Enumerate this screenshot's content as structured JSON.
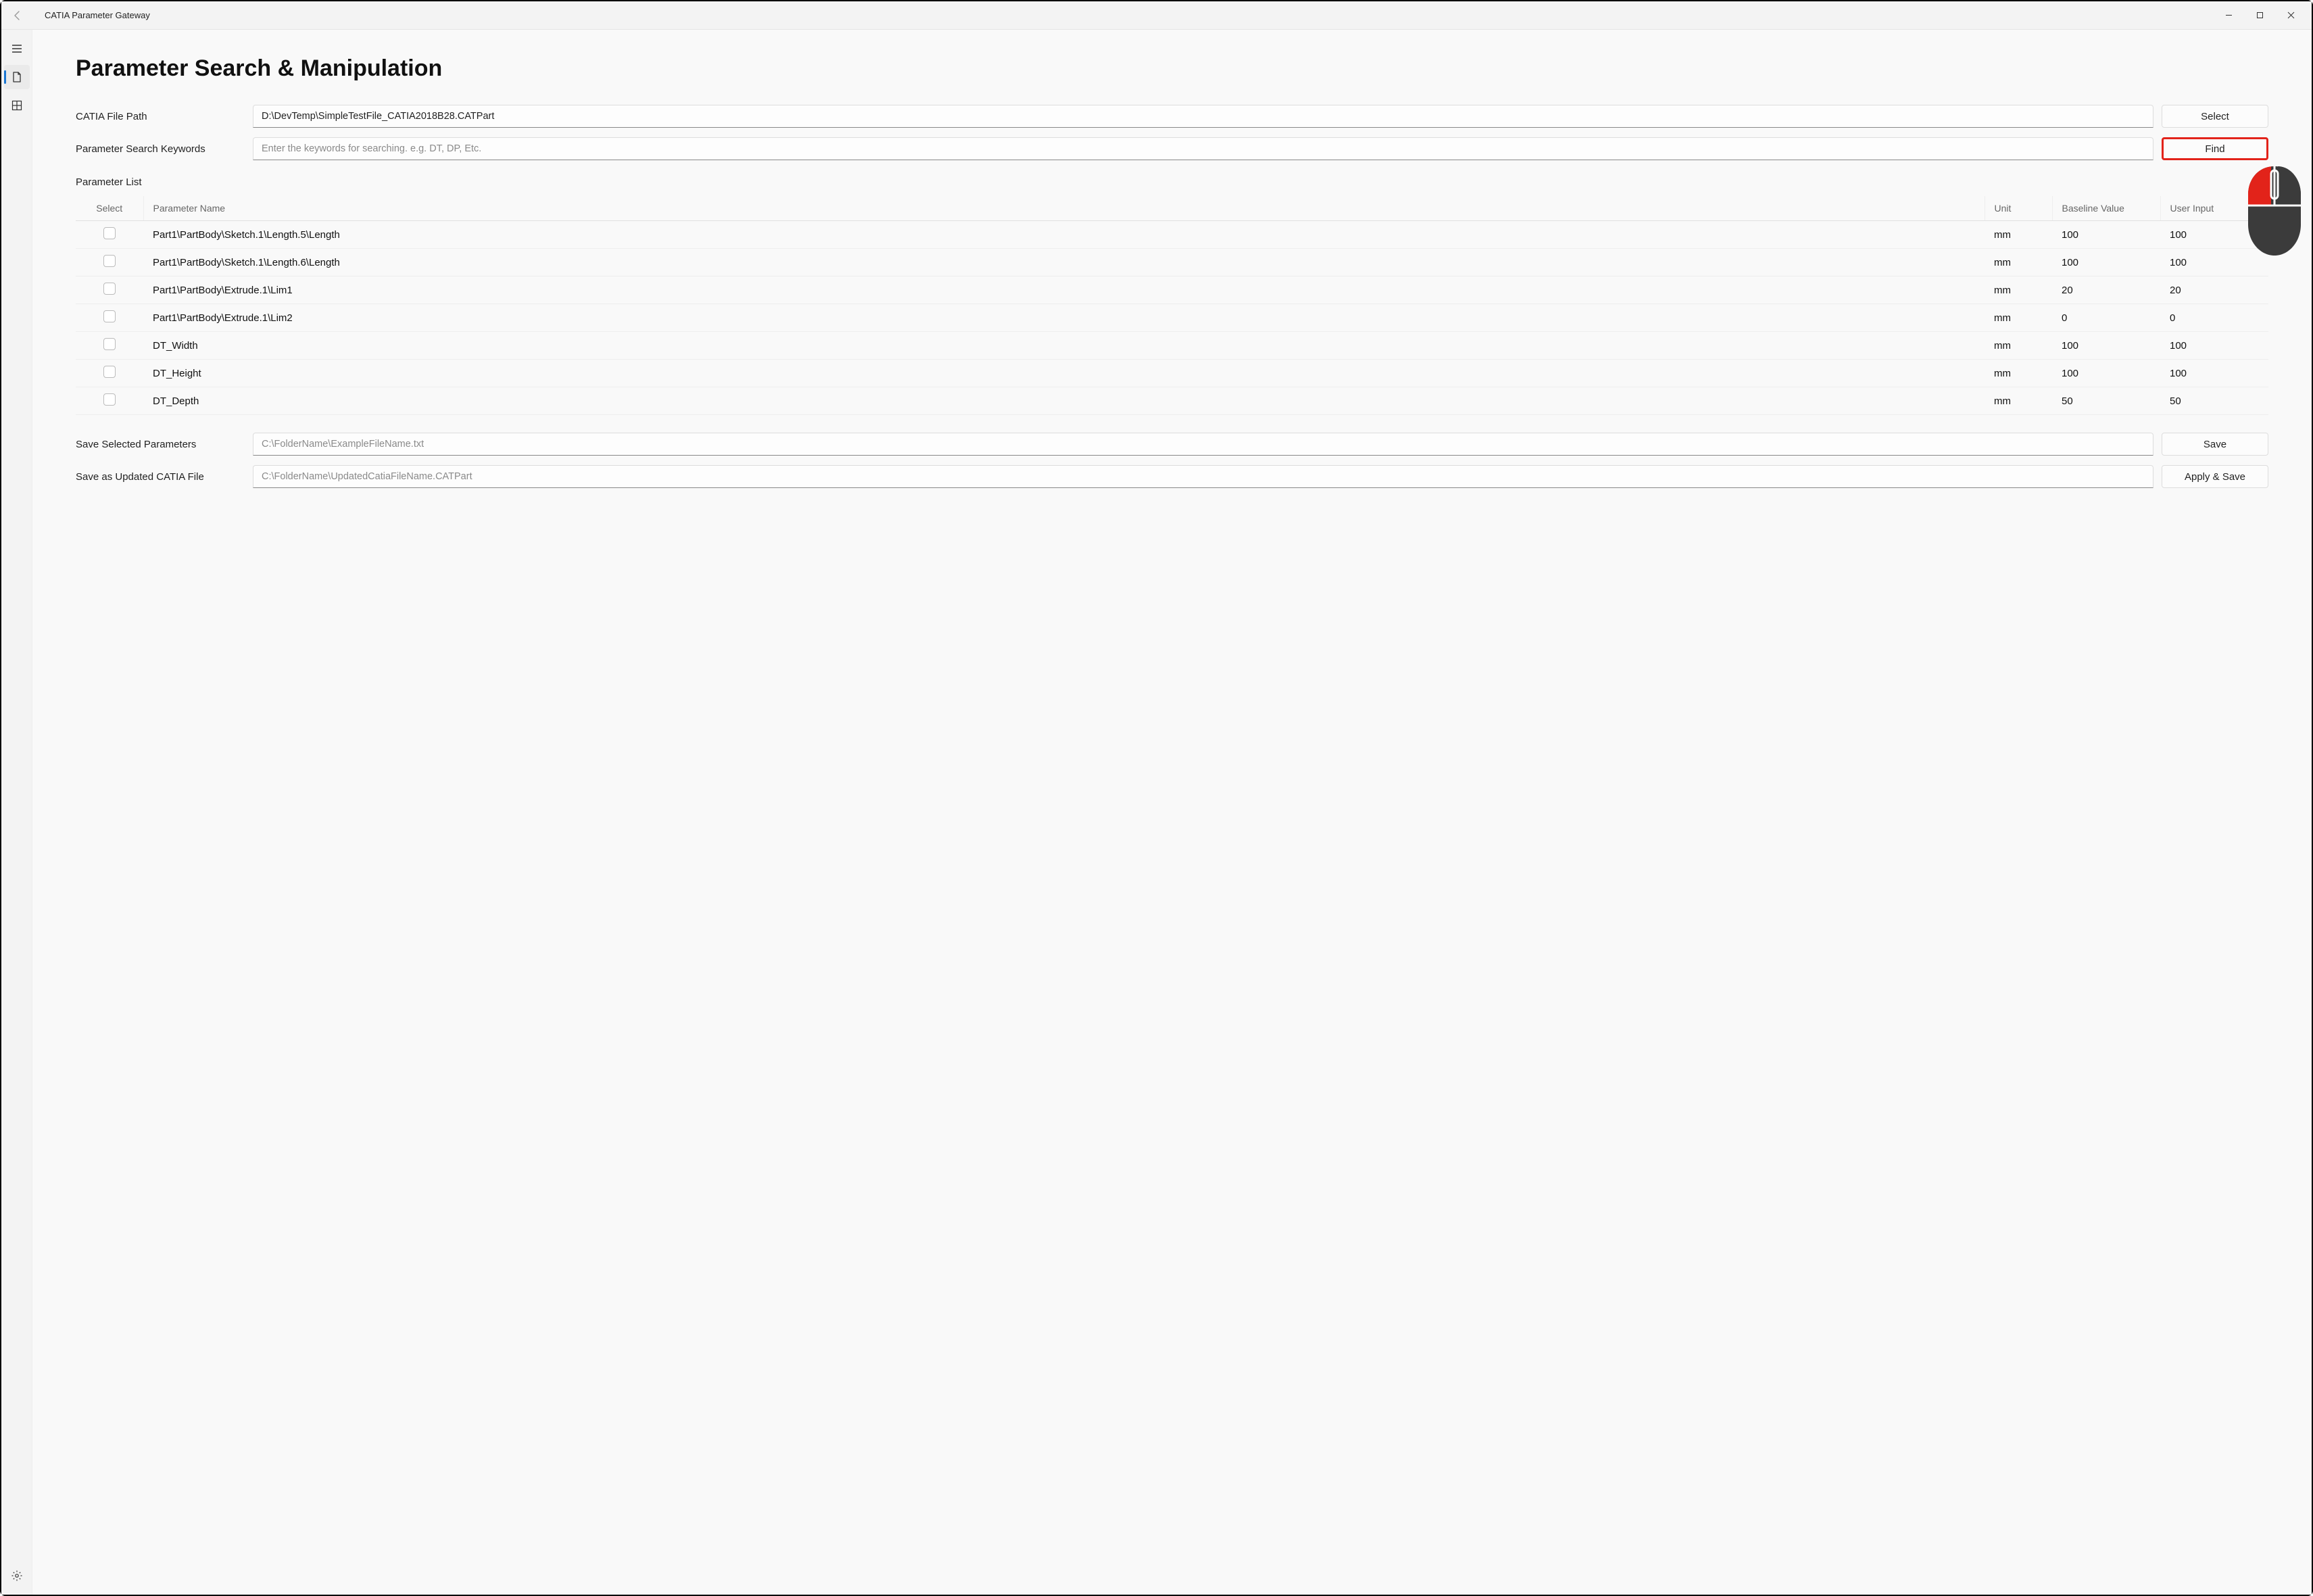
{
  "app": {
    "title": "CATIA Parameter Gateway"
  },
  "main": {
    "heading": "Parameter Search & Manipulation",
    "file_path_label": "CATIA File Path",
    "file_path_value": "D:\\DevTemp\\SimpleTestFile_CATIA2018B28.CATPart",
    "select_btn": "Select",
    "keywords_label": "Parameter Search Keywords",
    "keywords_placeholder": "Enter the keywords for searching. e.g. DT, DP, Etc.",
    "find_btn": "Find",
    "parameter_list_label": "Parameter List",
    "table": {
      "headers": {
        "select": "Select",
        "name": "Parameter Name",
        "unit": "Unit",
        "baseline": "Baseline Value",
        "user": "User Input"
      },
      "rows": [
        {
          "name": "Part1\\PartBody\\Sketch.1\\Length.5\\Length",
          "unit": "mm",
          "baseline": "100",
          "user": "100"
        },
        {
          "name": "Part1\\PartBody\\Sketch.1\\Length.6\\Length",
          "unit": "mm",
          "baseline": "100",
          "user": "100"
        },
        {
          "name": "Part1\\PartBody\\Extrude.1\\Lim1",
          "unit": "mm",
          "baseline": "20",
          "user": "20"
        },
        {
          "name": "Part1\\PartBody\\Extrude.1\\Lim2",
          "unit": "mm",
          "baseline": "0",
          "user": "0"
        },
        {
          "name": "DT_Width",
          "unit": "mm",
          "baseline": "100",
          "user": "100"
        },
        {
          "name": "DT_Height",
          "unit": "mm",
          "baseline": "100",
          "user": "100"
        },
        {
          "name": "DT_Depth",
          "unit": "mm",
          "baseline": "50",
          "user": "50"
        }
      ]
    },
    "save_selected_label": "Save Selected Parameters",
    "save_selected_placeholder": "C:\\FolderName\\ExampleFileName.txt",
    "save_btn": "Save",
    "save_updated_label": "Save as Updated CATIA File",
    "save_updated_placeholder": "C:\\FolderName\\UpdatedCatiaFileName.CATPart",
    "apply_save_btn": "Apply & Save"
  }
}
